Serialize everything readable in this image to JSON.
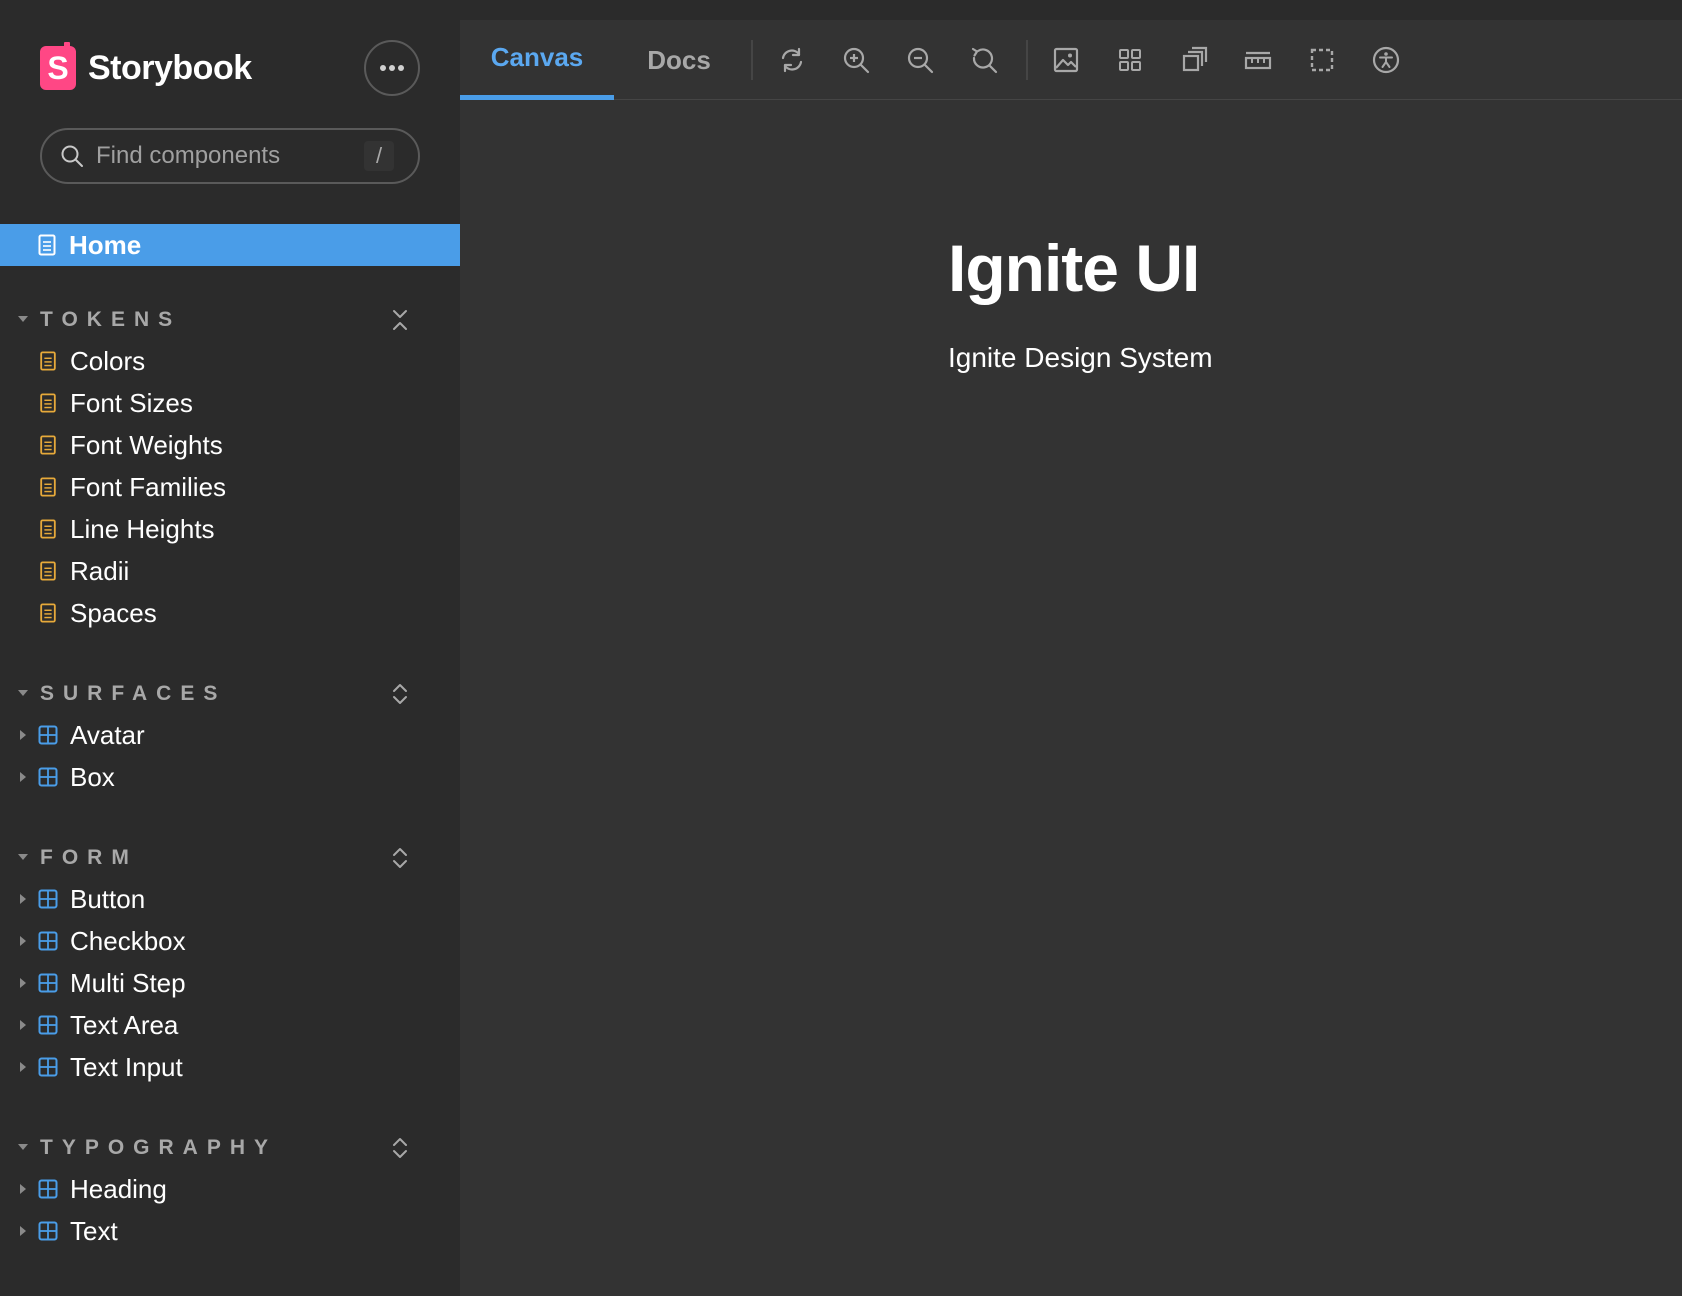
{
  "brand": {
    "name": "Storybook",
    "logo_letter": "S",
    "logo_color": "#ff4785"
  },
  "menu_button": {
    "icon": "ellipsis-icon"
  },
  "search": {
    "placeholder": "Find components",
    "shortcut": "/"
  },
  "home": {
    "label": "Home",
    "icon": "document-icon"
  },
  "groups": [
    {
      "title": "TOKENS",
      "expanded": true,
      "toggle_icon": "collapse-all-icon",
      "items": [
        {
          "label": "Colors",
          "icon": "document-icon"
        },
        {
          "label": "Font Sizes",
          "icon": "document-icon"
        },
        {
          "label": "Font Weights",
          "icon": "document-icon"
        },
        {
          "label": "Font Families",
          "icon": "document-icon"
        },
        {
          "label": "Line Heights",
          "icon": "document-icon"
        },
        {
          "label": "Radii",
          "icon": "document-icon"
        },
        {
          "label": "Spaces",
          "icon": "document-icon"
        }
      ]
    },
    {
      "title": "SURFACES",
      "expanded": true,
      "toggle_icon": "expand-all-icon",
      "items": [
        {
          "label": "Avatar",
          "icon": "component-icon"
        },
        {
          "label": "Box",
          "icon": "component-icon"
        }
      ]
    },
    {
      "title": "FORM",
      "expanded": true,
      "toggle_icon": "expand-all-icon",
      "items": [
        {
          "label": "Button",
          "icon": "component-icon"
        },
        {
          "label": "Checkbox",
          "icon": "component-icon"
        },
        {
          "label": "Multi Step",
          "icon": "component-icon"
        },
        {
          "label": "Text Area",
          "icon": "component-icon"
        },
        {
          "label": "Text Input",
          "icon": "component-icon"
        }
      ]
    },
    {
      "title": "TYPOGRAPHY",
      "expanded": true,
      "toggle_icon": "expand-all-icon",
      "items": [
        {
          "label": "Heading",
          "icon": "component-icon"
        },
        {
          "label": "Text",
          "icon": "component-icon"
        }
      ]
    }
  ],
  "tabs": [
    {
      "label": "Canvas",
      "active": true
    },
    {
      "label": "Docs",
      "active": false
    }
  ],
  "tools": [
    "refresh-icon",
    "zoom-in-icon",
    "zoom-out-icon",
    "reset-zoom-icon",
    "background-image-icon",
    "grid-icon",
    "viewport-icon",
    "measure-icon",
    "outline-icon",
    "accessibility-icon"
  ],
  "preview": {
    "title": "Ignite UI",
    "subtitle": "Ignite Design System"
  },
  "colors": {
    "accent": "#4a9de8",
    "document_icon": "#e6a93a",
    "component_icon": "#4a9de8",
    "sidebar_bg": "#2b2b2b",
    "canvas_bg": "#333333"
  }
}
